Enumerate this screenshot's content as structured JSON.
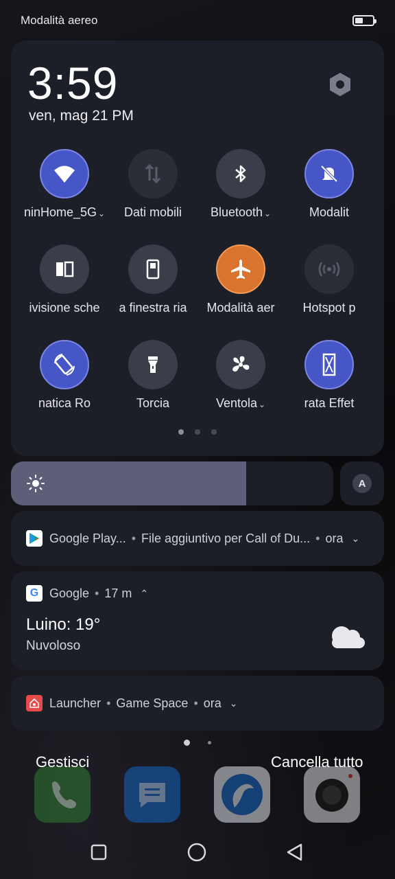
{
  "status_bar": {
    "left_text": "Modalità aereo",
    "battery_icon": "battery-icon"
  },
  "quick_settings": {
    "time": "3:59",
    "date": "ven, mag 21 PM",
    "settings_icon": "gear-icon",
    "tiles": [
      {
        "label": "ninHome_5G",
        "chevron": "⌄",
        "icon": "wifi-icon",
        "state": "on"
      },
      {
        "label": "Dati mobili",
        "chevron": "",
        "icon": "mobile-data-icon",
        "state": "dim"
      },
      {
        "label": "Bluetooth",
        "chevron": "⌄",
        "icon": "bluetooth-icon",
        "state": "off"
      },
      {
        "label": "Modalit",
        "chevron": "",
        "icon": "silent-mode-icon",
        "state": "on"
      },
      {
        "label": "ivisione sche",
        "chevron": "",
        "icon": "split-screen-icon",
        "state": "off"
      },
      {
        "label": "a finestra ria",
        "chevron": "",
        "icon": "floating-window-icon",
        "state": "off"
      },
      {
        "label": "Modalità aer",
        "chevron": "",
        "icon": "airplane-icon",
        "state": "orange"
      },
      {
        "label": "Hotspot p",
        "chevron": "",
        "icon": "hotspot-icon",
        "state": "dim"
      },
      {
        "label": "natica      Ro",
        "chevron": "",
        "icon": "auto-rotate-icon",
        "state": "on"
      },
      {
        "label": "Torcia",
        "chevron": "",
        "icon": "flashlight-icon",
        "state": "off"
      },
      {
        "label": "Ventola",
        "chevron": "⌄",
        "icon": "fan-icon",
        "state": "off"
      },
      {
        "label": "rata      Effet",
        "chevron": "",
        "icon": "screen-effect-icon",
        "state": "on"
      }
    ],
    "page_count": 3,
    "active_page": 0
  },
  "brightness": {
    "level": 0.73,
    "icon": "sun-icon",
    "auto_label": "A"
  },
  "notifications": [
    {
      "app": "Google Play...",
      "detail": "File aggiuntivo per Call of Du...",
      "time": "ora",
      "expand_glyph": "⌄"
    },
    {
      "app": "Google",
      "time": "17 m",
      "expand_glyph": "⌃",
      "title": "Luino: 19°",
      "text": "Nuvoloso",
      "weather_icon": "cloud-icon"
    },
    {
      "app": "Launcher",
      "detail": "Game Space",
      "time": "ora",
      "expand_glyph": "⌄"
    }
  ],
  "actions": {
    "manage": "Gestisci",
    "clear_all": "Cancella tutto"
  },
  "colors": {
    "accent_on": "#4756c6",
    "airplane_orange": "#d9732e",
    "panel": "#1d1f28"
  }
}
